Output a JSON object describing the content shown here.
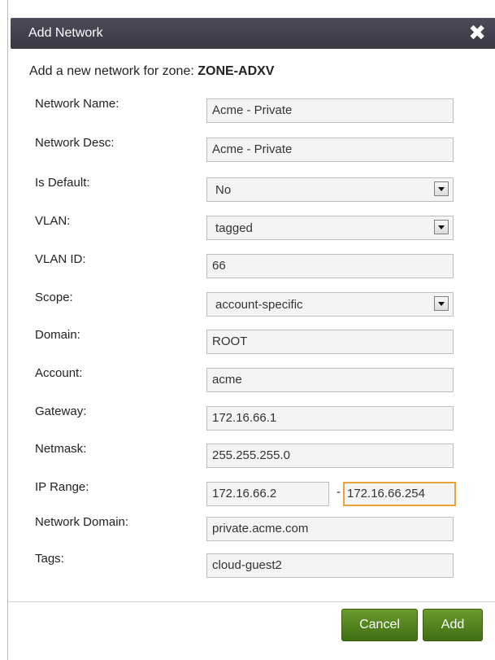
{
  "dialog": {
    "title": "Add Network",
    "close_symbol": "✖",
    "subtitle_prefix": "Add a new network for zone:",
    "zone_name": "ZONE-ADXV"
  },
  "fields": {
    "network_name": {
      "label": "Network Name:",
      "value": "Acme - Private"
    },
    "network_desc": {
      "label": "Network Desc:",
      "value": "Acme - Private"
    },
    "is_default": {
      "label": "Is Default:",
      "value": "No"
    },
    "vlan": {
      "label": "VLAN:",
      "value": "tagged"
    },
    "vlan_id": {
      "label": "VLAN ID:",
      "value": "66"
    },
    "scope": {
      "label": "Scope:",
      "value": "account-specific"
    },
    "domain": {
      "label": "Domain:",
      "value": "ROOT"
    },
    "account": {
      "label": "Account:",
      "value": "acme"
    },
    "gateway": {
      "label": "Gateway:",
      "value": "172.16.66.1"
    },
    "netmask": {
      "label": "Netmask:",
      "value": "255.255.255.0"
    },
    "ip_range": {
      "label": "IP Range:",
      "start": "172.16.66.2",
      "separator": "-",
      "end": "172.16.66.254"
    },
    "network_domain": {
      "label": "Network Domain:",
      "value": "private.acme.com"
    },
    "tags": {
      "label": "Tags:",
      "value": "cloud-guest2"
    }
  },
  "buttons": {
    "cancel": "Cancel",
    "add": "Add"
  },
  "icons": {
    "close": "close-icon",
    "dropdown": "chevron-down-icon"
  },
  "colors": {
    "titlebar": "#3f3d48",
    "button_green": "#4f8020",
    "focus_border": "#e8a43a"
  }
}
